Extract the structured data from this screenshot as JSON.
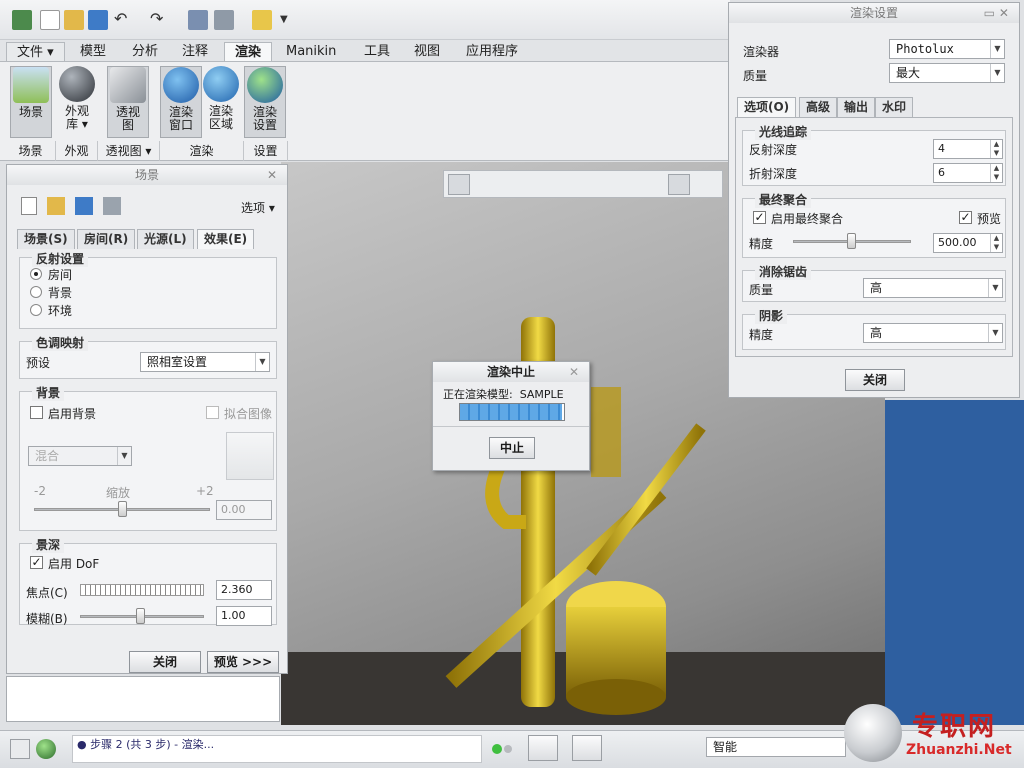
{
  "ribbon": {
    "tabs": [
      "文件",
      "模型",
      "分析",
      "注释",
      "渲染",
      "Manikin",
      "工具",
      "视图",
      "应用程序"
    ],
    "active_tab": "渲染",
    "buttons": [
      {
        "label": "场景",
        "label2": "",
        "icon": "scene-icon"
      },
      {
        "label": "外观",
        "label2": "库 ▾",
        "icon": "appearance-sphere-icon"
      },
      {
        "label": "透视",
        "label2": "图",
        "icon": "perspective-icon"
      },
      {
        "label": "渲染",
        "label2": "窗口",
        "icon": "render-teapot-icon"
      },
      {
        "label": "渲染",
        "label2": "区域",
        "icon": "render-region-icon"
      },
      {
        "label": "渲染",
        "label2": "设置",
        "icon": "render-settings-icon"
      }
    ],
    "groups": [
      "场景",
      "外观",
      "透视图 ▾",
      "渲染",
      "设置"
    ]
  },
  "scene_panel": {
    "title": "场景",
    "options_label": "选项 ▾",
    "tabs": [
      "场景(S)",
      "房间(R)",
      "光源(L)",
      "效果(E)"
    ],
    "active_tab": "效果(E)",
    "reflection": {
      "title": "反射设置",
      "options": [
        "房间",
        "背景",
        "环境"
      ],
      "selected": "房间"
    },
    "tone": {
      "title": "色调映射",
      "preset_label": "预设",
      "preset_value": "照相室设置"
    },
    "background": {
      "title": "背景",
      "enable_label": "启用背景",
      "fit_label": "拟合图像",
      "blend_value": "混合",
      "scale_min": "-2",
      "scale_label": "缩放",
      "scale_max": "+2",
      "scale_value": "0.00"
    },
    "dof": {
      "title": "景深",
      "enable_label": "启用 DoF",
      "focus_label": "焦点(C)",
      "focus_value": "2.360",
      "blur_label": "模糊(B)",
      "blur_value": "1.00"
    },
    "close_label": "关闭",
    "preview_label": "预览 >>>"
  },
  "render_settings": {
    "title": "渲染设置",
    "renderer_label": "渲染器",
    "renderer_value": "Photolux",
    "quality_label": "质量",
    "quality_value": "最大",
    "tabs": [
      "选项(O)",
      "高级",
      "输出",
      "水印"
    ],
    "active_tab": "选项(O)",
    "raytrace": {
      "title": "光线追踪",
      "reflect_label": "反射深度",
      "reflect_value": "4",
      "refract_label": "折射深度",
      "refract_value": "6"
    },
    "final_gather": {
      "title": "最终聚合",
      "enable_label": "启用最终聚合",
      "preview_label": "预览",
      "precision_label": "精度",
      "precision_value": "500.00"
    },
    "antialias": {
      "title": "消除锯齿",
      "quality_label": "质量",
      "quality_value": "高"
    },
    "shadow": {
      "title": "阴影",
      "precision_label": "精度",
      "precision_value": "高"
    },
    "close_label": "关闭"
  },
  "dialog": {
    "title": "渲染中止",
    "message": "正在渲染模型:  SAMPLE",
    "progress": 0.98,
    "stop_label": "中止"
  },
  "status": {
    "step_text": "● 步骤 2 (共 3 步) - 渲染...",
    "filter_value": "智能"
  },
  "watermark": {
    "brand_cn": "专职网",
    "brand_url": "Zhuanzhi.Net"
  },
  "colors": {
    "accent": "#2e5fa0",
    "gold": "#d4b51c",
    "progress": "#3b8bd4"
  }
}
